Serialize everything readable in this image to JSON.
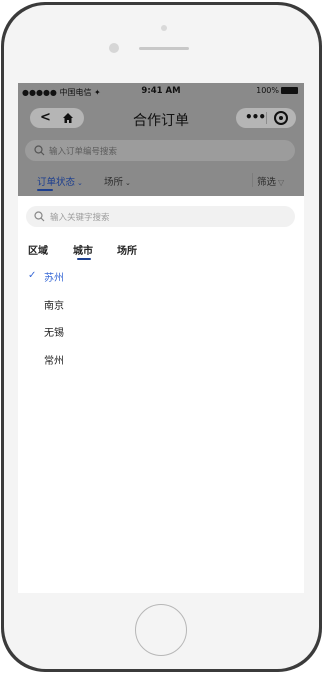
{
  "status_bar": {
    "carrier": "●●●●● 中国电信 ✦",
    "time": "9:41 AM",
    "battery": "100%"
  },
  "navbar": {
    "title": "合作订单",
    "back_icon": "chevron-left-icon",
    "home_icon": "home-icon",
    "more_icon": "more-dots-icon",
    "close_icon": "target-icon"
  },
  "top_search": {
    "placeholder": "输入订单编号搜索"
  },
  "filter_tabs": {
    "order_status": "订单状态",
    "venue": "场所",
    "filter": "筛选"
  },
  "panel": {
    "search_placeholder": "输入关键字搜索",
    "levels": {
      "region": "区域",
      "city": "城市",
      "venue": "场所"
    },
    "cities": [
      "苏州",
      "南京",
      "无锡",
      "常州"
    ],
    "selected_city": "苏州"
  },
  "colors": {
    "accent": "#1d3f8f",
    "check": "#3b6bd6"
  }
}
